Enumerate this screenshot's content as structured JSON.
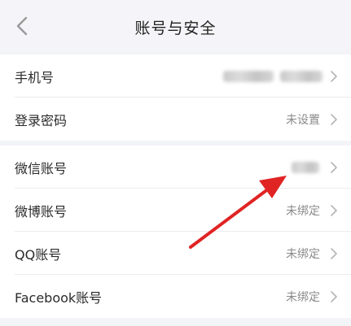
{
  "header": {
    "title": "账号与安全",
    "back_icon": "chevron-left-icon"
  },
  "security": {
    "phone_label": "手机号",
    "password_label": "登录密码",
    "password_value": "未设置"
  },
  "accounts": {
    "wechat_label": "微信账号",
    "weibo_label": "微博账号",
    "weibo_value": "未绑定",
    "qq_label": "QQ账号",
    "qq_value": "未绑定",
    "facebook_label": "Facebook账号",
    "facebook_value": "未绑定"
  },
  "annotation": {
    "arrow_color": "#e02424"
  }
}
